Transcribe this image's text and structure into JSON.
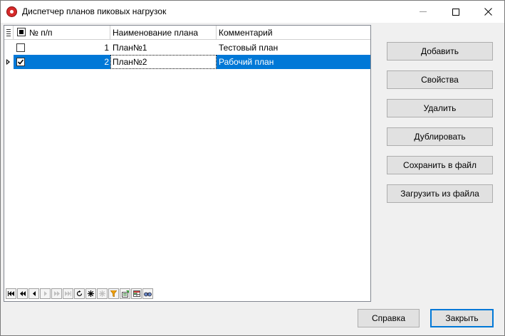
{
  "window": {
    "title": "Диспетчер планов пиковых нагрузок",
    "controls": {
      "minimize_icon": "minimize-icon",
      "maximize_icon": "maximize-icon",
      "close_icon": "close-icon"
    }
  },
  "grid": {
    "columns": {
      "number": "№ п/п",
      "name": "Наименование плана",
      "comment": "Комментарий"
    },
    "rows": [
      {
        "checked": false,
        "number": "1",
        "name": "План№1",
        "comment": "Тестовый план",
        "selected": false
      },
      {
        "checked": true,
        "number": "2",
        "name": "План№2",
        "comment": "Рабочий план",
        "selected": true
      }
    ],
    "navigator_icons": [
      "first-record-icon",
      "prior-page-icon",
      "prior-record-icon",
      "next-record-icon",
      "next-page-icon",
      "last-record-icon",
      "refresh-icon",
      "add-record-icon",
      "delete-record-icon",
      "filter-icon",
      "export-icon",
      "grid-settings-icon",
      "find-icon"
    ]
  },
  "actions": {
    "add": "Добавить",
    "properties": "Свойства",
    "delete": "Удалить",
    "duplicate": "Дублировать",
    "save_to_file": "Сохранить в файл",
    "load_from_file": "Загрузить из файла"
  },
  "footer": {
    "help": "Справка",
    "close": "Закрыть"
  },
  "colors": {
    "selection": "#0078d7",
    "button_face": "#e1e1e1",
    "dialog_background": "#f0f0f0"
  }
}
